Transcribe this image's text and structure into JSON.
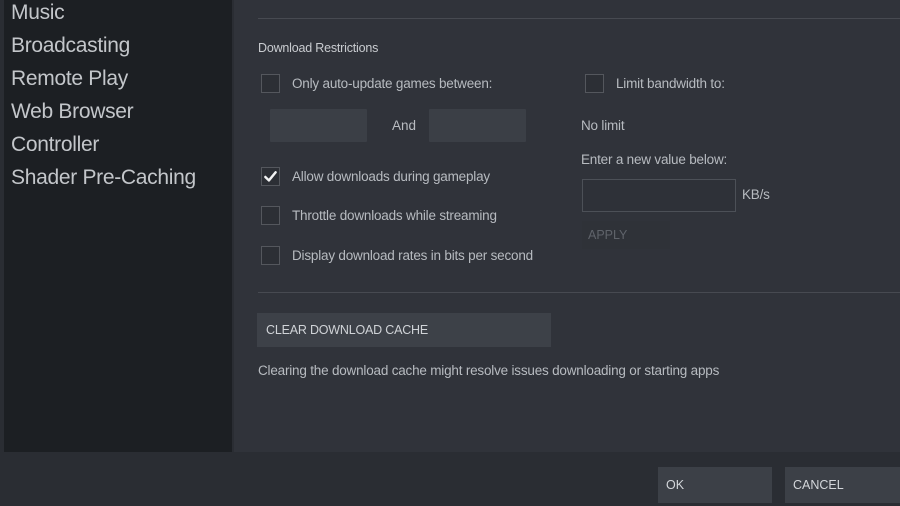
{
  "sidebar": {
    "items": [
      {
        "label": "Music"
      },
      {
        "label": "Broadcasting"
      },
      {
        "label": "Remote Play"
      },
      {
        "label": "Web Browser"
      },
      {
        "label": "Controller"
      },
      {
        "label": "Shader Pre-Caching"
      }
    ]
  },
  "downloads": {
    "section_title": "Download Restrictions",
    "auto_update": {
      "label": "Only auto-update games between:",
      "checked": false
    },
    "time_start": {
      "value": ""
    },
    "time_end": {
      "value": ""
    },
    "and_label": "And",
    "limit_bandwidth": {
      "label": "Limit bandwidth to:",
      "checked": false
    },
    "current_limit": "No limit",
    "enter_value_label": "Enter a new value below:",
    "bandwidth_input": {
      "value": "",
      "placeholder": ""
    },
    "unit_label": "KB/s",
    "apply_label": "APPLY",
    "options": [
      {
        "label": "Allow downloads during gameplay",
        "checked": true
      },
      {
        "label": "Throttle downloads while streaming",
        "checked": false
      },
      {
        "label": "Display download rates in bits per second",
        "checked": false
      }
    ],
    "clear_cache_label": "CLEAR DOWNLOAD CACHE",
    "clear_cache_hint": "Clearing the download cache might resolve issues downloading or starting apps"
  },
  "footer": {
    "ok_label": "OK",
    "cancel_label": "CANCEL"
  }
}
